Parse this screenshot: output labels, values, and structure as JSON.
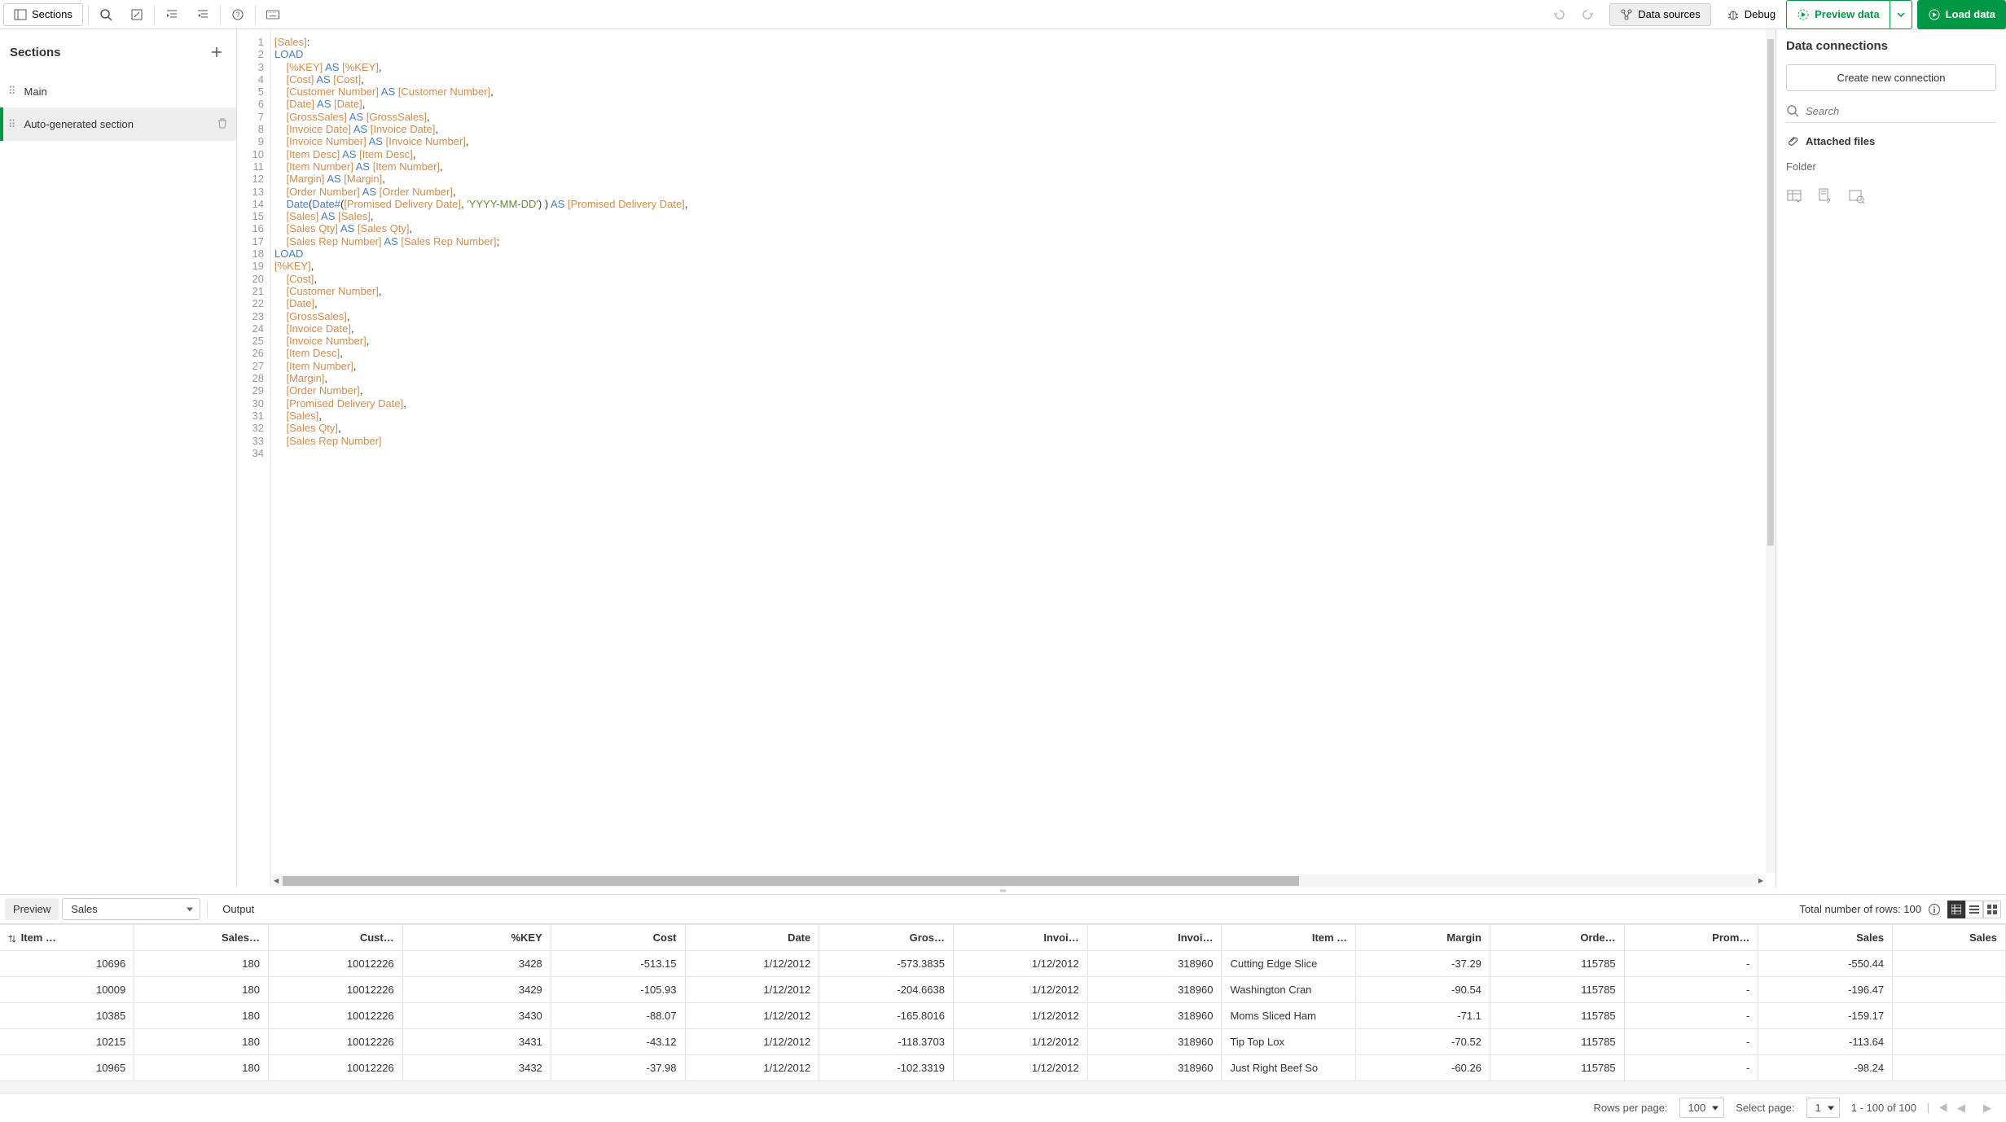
{
  "toolbar": {
    "sections_label": "Sections",
    "data_sources_label": "Data sources",
    "debug_label": "Debug",
    "preview_data_label": "Preview data",
    "load_data_label": "Load data"
  },
  "sidebar": {
    "title": "Sections",
    "items": [
      {
        "label": "Main",
        "active": false
      },
      {
        "label": "Auto-generated section",
        "active": true
      }
    ]
  },
  "editor": {
    "lines": [
      [
        {
          "t": "bracket",
          "v": "[Sales]"
        },
        {
          "t": "punct",
          "v": ":"
        }
      ],
      [
        {
          "t": "kw",
          "v": "LOAD"
        }
      ],
      [
        {
          "t": "indent",
          "v": "    "
        },
        {
          "t": "bracket",
          "v": "[%KEY]"
        },
        {
          "t": "punct",
          "v": " "
        },
        {
          "t": "kw",
          "v": "AS"
        },
        {
          "t": "punct",
          "v": " "
        },
        {
          "t": "bracket",
          "v": "[%KEY]"
        },
        {
          "t": "punct",
          "v": ","
        }
      ],
      [
        {
          "t": "indent",
          "v": "    "
        },
        {
          "t": "bracket",
          "v": "[Cost]"
        },
        {
          "t": "punct",
          "v": " "
        },
        {
          "t": "kw",
          "v": "AS"
        },
        {
          "t": "punct",
          "v": " "
        },
        {
          "t": "bracket",
          "v": "[Cost]"
        },
        {
          "t": "punct",
          "v": ","
        }
      ],
      [
        {
          "t": "indent",
          "v": "    "
        },
        {
          "t": "bracket",
          "v": "[Customer Number]"
        },
        {
          "t": "punct",
          "v": " "
        },
        {
          "t": "kw",
          "v": "AS"
        },
        {
          "t": "punct",
          "v": " "
        },
        {
          "t": "bracket",
          "v": "[Customer Number]"
        },
        {
          "t": "punct",
          "v": ","
        }
      ],
      [
        {
          "t": "indent",
          "v": "    "
        },
        {
          "t": "bracket",
          "v": "[Date]"
        },
        {
          "t": "punct",
          "v": " "
        },
        {
          "t": "kw",
          "v": "AS"
        },
        {
          "t": "punct",
          "v": " "
        },
        {
          "t": "bracket",
          "v": "[Date]"
        },
        {
          "t": "punct",
          "v": ","
        }
      ],
      [
        {
          "t": "indent",
          "v": "    "
        },
        {
          "t": "bracket",
          "v": "[GrossSales]"
        },
        {
          "t": "punct",
          "v": " "
        },
        {
          "t": "kw",
          "v": "AS"
        },
        {
          "t": "punct",
          "v": " "
        },
        {
          "t": "bracket",
          "v": "[GrossSales]"
        },
        {
          "t": "punct",
          "v": ","
        }
      ],
      [
        {
          "t": "indent",
          "v": "    "
        },
        {
          "t": "bracket",
          "v": "[Invoice Date]"
        },
        {
          "t": "punct",
          "v": " "
        },
        {
          "t": "kw",
          "v": "AS"
        },
        {
          "t": "punct",
          "v": " "
        },
        {
          "t": "bracket",
          "v": "[Invoice Date]"
        },
        {
          "t": "punct",
          "v": ","
        }
      ],
      [
        {
          "t": "indent",
          "v": "    "
        },
        {
          "t": "bracket",
          "v": "[Invoice Number]"
        },
        {
          "t": "punct",
          "v": " "
        },
        {
          "t": "kw",
          "v": "AS"
        },
        {
          "t": "punct",
          "v": " "
        },
        {
          "t": "bracket",
          "v": "[Invoice Number]"
        },
        {
          "t": "punct",
          "v": ","
        }
      ],
      [
        {
          "t": "indent",
          "v": "    "
        },
        {
          "t": "bracket",
          "v": "[Item Desc]"
        },
        {
          "t": "punct",
          "v": " "
        },
        {
          "t": "kw",
          "v": "AS"
        },
        {
          "t": "punct",
          "v": " "
        },
        {
          "t": "bracket",
          "v": "[Item Desc]"
        },
        {
          "t": "punct",
          "v": ","
        }
      ],
      [
        {
          "t": "indent",
          "v": "    "
        },
        {
          "t": "bracket",
          "v": "[Item Number]"
        },
        {
          "t": "punct",
          "v": " "
        },
        {
          "t": "kw",
          "v": "AS"
        },
        {
          "t": "punct",
          "v": " "
        },
        {
          "t": "bracket",
          "v": "[Item Number]"
        },
        {
          "t": "punct",
          "v": ","
        }
      ],
      [
        {
          "t": "indent",
          "v": "    "
        },
        {
          "t": "bracket",
          "v": "[Margin]"
        },
        {
          "t": "punct",
          "v": " "
        },
        {
          "t": "kw",
          "v": "AS"
        },
        {
          "t": "punct",
          "v": " "
        },
        {
          "t": "bracket",
          "v": "[Margin]"
        },
        {
          "t": "punct",
          "v": ","
        }
      ],
      [
        {
          "t": "indent",
          "v": "    "
        },
        {
          "t": "bracket",
          "v": "[Order Number]"
        },
        {
          "t": "punct",
          "v": " "
        },
        {
          "t": "kw",
          "v": "AS"
        },
        {
          "t": "punct",
          "v": " "
        },
        {
          "t": "bracket",
          "v": "[Order Number]"
        },
        {
          "t": "punct",
          "v": ","
        }
      ],
      [
        {
          "t": "indent",
          "v": "    "
        },
        {
          "t": "fn",
          "v": "Date"
        },
        {
          "t": "punct",
          "v": "("
        },
        {
          "t": "fn",
          "v": "Date#"
        },
        {
          "t": "punct",
          "v": "("
        },
        {
          "t": "bracket",
          "v": "[Promised Delivery Date]"
        },
        {
          "t": "punct",
          "v": ", "
        },
        {
          "t": "str",
          "v": "'YYYY-MM-DD'"
        },
        {
          "t": "punct",
          "v": ") ) "
        },
        {
          "t": "kw",
          "v": "AS"
        },
        {
          "t": "punct",
          "v": " "
        },
        {
          "t": "bracket",
          "v": "[Promised Delivery Date]"
        },
        {
          "t": "punct",
          "v": ","
        }
      ],
      [
        {
          "t": "indent",
          "v": "    "
        },
        {
          "t": "bracket",
          "v": "[Sales]"
        },
        {
          "t": "punct",
          "v": " "
        },
        {
          "t": "kw",
          "v": "AS"
        },
        {
          "t": "punct",
          "v": " "
        },
        {
          "t": "bracket",
          "v": "[Sales]"
        },
        {
          "t": "punct",
          "v": ","
        }
      ],
      [
        {
          "t": "indent",
          "v": "    "
        },
        {
          "t": "bracket",
          "v": "[Sales Qty]"
        },
        {
          "t": "punct",
          "v": " "
        },
        {
          "t": "kw",
          "v": "AS"
        },
        {
          "t": "punct",
          "v": " "
        },
        {
          "t": "bracket",
          "v": "[Sales Qty]"
        },
        {
          "t": "punct",
          "v": ","
        }
      ],
      [
        {
          "t": "indent",
          "v": "    "
        },
        {
          "t": "bracket",
          "v": "[Sales Rep Number]"
        },
        {
          "t": "punct",
          "v": " "
        },
        {
          "t": "kw",
          "v": "AS"
        },
        {
          "t": "punct",
          "v": " "
        },
        {
          "t": "bracket",
          "v": "[Sales Rep Number]"
        },
        {
          "t": "punct",
          "v": ";"
        }
      ],
      [
        {
          "t": "kw",
          "v": "LOAD"
        }
      ],
      [
        {
          "t": "bracket",
          "v": "[%KEY]"
        },
        {
          "t": "punct",
          "v": ","
        }
      ],
      [
        {
          "t": "indent",
          "v": "    "
        },
        {
          "t": "bracket",
          "v": "[Cost]"
        },
        {
          "t": "punct",
          "v": ","
        }
      ],
      [
        {
          "t": "indent",
          "v": "    "
        },
        {
          "t": "bracket",
          "v": "[Customer Number]"
        },
        {
          "t": "punct",
          "v": ","
        }
      ],
      [
        {
          "t": "indent",
          "v": "    "
        },
        {
          "t": "bracket",
          "v": "[Date]"
        },
        {
          "t": "punct",
          "v": ","
        }
      ],
      [
        {
          "t": "indent",
          "v": "    "
        },
        {
          "t": "bracket",
          "v": "[GrossSales]"
        },
        {
          "t": "punct",
          "v": ","
        }
      ],
      [
        {
          "t": "indent",
          "v": "    "
        },
        {
          "t": "bracket",
          "v": "[Invoice Date]"
        },
        {
          "t": "punct",
          "v": ","
        }
      ],
      [
        {
          "t": "indent",
          "v": "    "
        },
        {
          "t": "bracket",
          "v": "[Invoice Number]"
        },
        {
          "t": "punct",
          "v": ","
        }
      ],
      [
        {
          "t": "indent",
          "v": "    "
        },
        {
          "t": "bracket",
          "v": "[Item Desc]"
        },
        {
          "t": "punct",
          "v": ","
        }
      ],
      [
        {
          "t": "indent",
          "v": "    "
        },
        {
          "t": "bracket",
          "v": "[Item Number]"
        },
        {
          "t": "punct",
          "v": ","
        }
      ],
      [
        {
          "t": "indent",
          "v": "    "
        },
        {
          "t": "bracket",
          "v": "[Margin]"
        },
        {
          "t": "punct",
          "v": ","
        }
      ],
      [
        {
          "t": "indent",
          "v": "    "
        },
        {
          "t": "bracket",
          "v": "[Order Number]"
        },
        {
          "t": "punct",
          "v": ","
        }
      ],
      [
        {
          "t": "indent",
          "v": "    "
        },
        {
          "t": "bracket",
          "v": "[Promised Delivery Date]"
        },
        {
          "t": "punct",
          "v": ","
        }
      ],
      [
        {
          "t": "indent",
          "v": "    "
        },
        {
          "t": "bracket",
          "v": "[Sales]"
        },
        {
          "t": "punct",
          "v": ","
        }
      ],
      [
        {
          "t": "indent",
          "v": "    "
        },
        {
          "t": "bracket",
          "v": "[Sales Qty]"
        },
        {
          "t": "punct",
          "v": ","
        }
      ],
      [
        {
          "t": "indent",
          "v": "    "
        },
        {
          "t": "bracket",
          "v": "[Sales Rep Number]"
        }
      ],
      []
    ],
    "line_count": 34
  },
  "rightpanel": {
    "title": "Data connections",
    "create_button": "Create new connection",
    "search_placeholder": "Search",
    "attached_files_label": "Attached files",
    "folder_label": "Folder"
  },
  "bottom": {
    "tab_preview": "Preview",
    "tab_output": "Output",
    "select_value": "Sales",
    "total_rows_label": "Total number of rows: 100",
    "grid": {
      "columns": [
        "Item …",
        "Sales…",
        "Cust…",
        "%KEY",
        "Cost",
        "Date",
        "Gros…",
        "Invoi…",
        "Invoi…",
        "Item …",
        "Margin",
        "Orde…",
        "Prom…",
        "Sales",
        "Sales"
      ],
      "rows": [
        [
          "10696",
          "180",
          "10012226",
          "3428",
          "-513.15",
          "1/12/2012",
          "-573.3835",
          "1/12/2012",
          "318960",
          "Cutting Edge Slice",
          "-37.29",
          "115785",
          "-",
          "-550.44",
          ""
        ],
        [
          "10009",
          "180",
          "10012226",
          "3429",
          "-105.93",
          "1/12/2012",
          "-204.6638",
          "1/12/2012",
          "318960",
          "Washington Cran",
          "-90.54",
          "115785",
          "-",
          "-196.47",
          ""
        ],
        [
          "10385",
          "180",
          "10012226",
          "3430",
          "-88.07",
          "1/12/2012",
          "-165.8016",
          "1/12/2012",
          "318960",
          "Moms Sliced Ham",
          "-71.1",
          "115785",
          "-",
          "-159.17",
          ""
        ],
        [
          "10215",
          "180",
          "10012226",
          "3431",
          "-43.12",
          "1/12/2012",
          "-118.3703",
          "1/12/2012",
          "318960",
          "Tip Top Lox",
          "-70.52",
          "115785",
          "-",
          "-113.64",
          ""
        ],
        [
          "10965",
          "180",
          "10012226",
          "3432",
          "-37.98",
          "1/12/2012",
          "-102.3319",
          "1/12/2012",
          "318960",
          "Just Right Beef So",
          "-60.26",
          "115785",
          "-",
          "-98.24",
          ""
        ]
      ]
    },
    "pager": {
      "rows_per_page_label": "Rows per page:",
      "rows_per_page_value": "100",
      "select_page_label": "Select page:",
      "select_page_value": "1",
      "range_label": "1 - 100 of 100"
    }
  }
}
